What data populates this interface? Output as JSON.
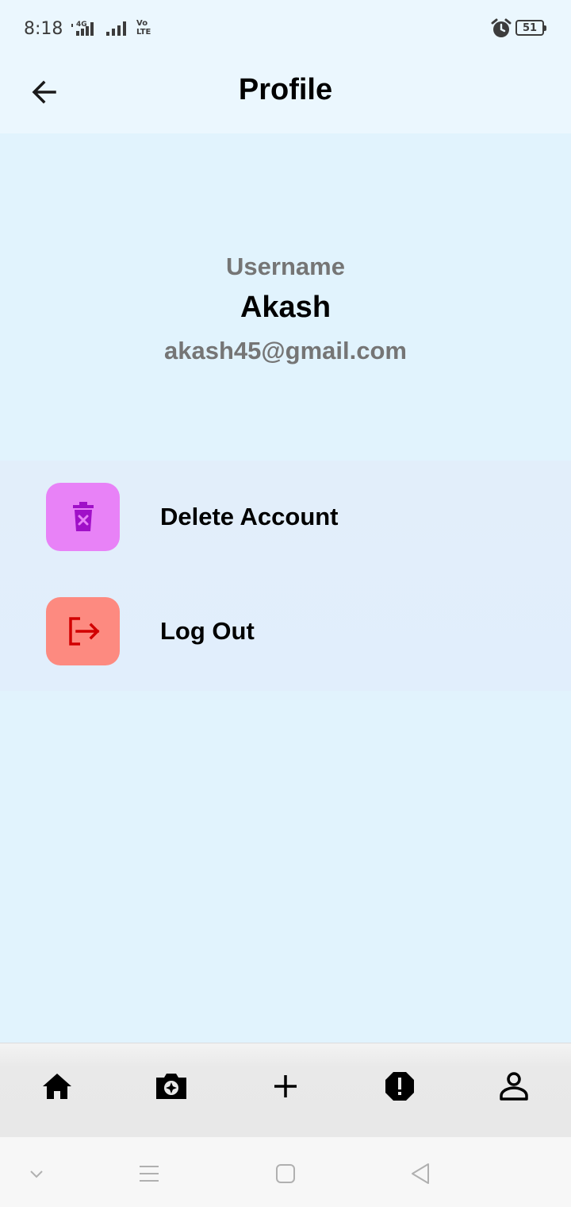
{
  "status_bar": {
    "time": "8:18",
    "network_label": "4G",
    "volte_label": "Vo\nLTE",
    "battery_level": "51",
    "icons": [
      "signal-4g-icon",
      "signal-icon",
      "volte-icon",
      "alarm-icon",
      "battery-icon"
    ]
  },
  "app_bar": {
    "title": "Profile",
    "back_icon": "arrow-left-icon"
  },
  "profile": {
    "username_label": "Username",
    "username": "Akash",
    "email": "akash45@gmail.com"
  },
  "actions": [
    {
      "label": "Delete Account",
      "icon": "delete-icon",
      "icon_bg": "#e882f7",
      "icon_color": "#a010c8"
    },
    {
      "label": "Log Out",
      "icon": "logout-icon",
      "icon_bg": "#fd8a80",
      "icon_color": "#d10000"
    }
  ],
  "bottom_nav": {
    "items": [
      "home-icon",
      "camera-icon",
      "add-icon",
      "alert-icon",
      "person-icon"
    ]
  },
  "system_nav": {
    "items": [
      "chevron-down-icon",
      "menu-icon",
      "square-home-icon",
      "back-triangle-icon"
    ]
  },
  "colors": {
    "background": "#e1f3fd",
    "header_background": "#ebf7fe",
    "muted_text": "#757575"
  }
}
